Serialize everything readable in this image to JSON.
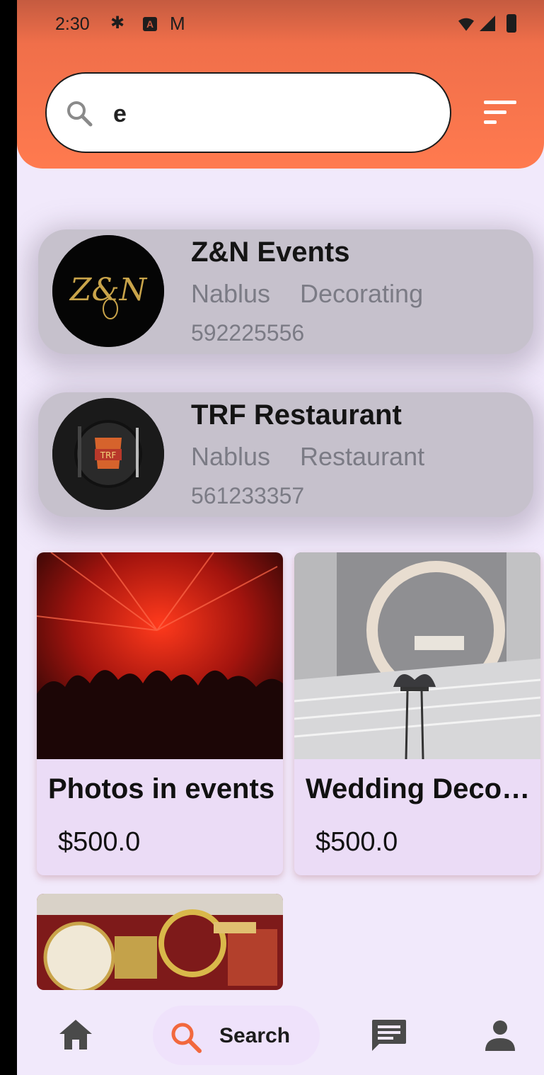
{
  "status_bar": {
    "time": "2:30"
  },
  "search": {
    "value": "e"
  },
  "providers": [
    {
      "name": "Z&N Events",
      "city": "Nablus",
      "category": "Decorating",
      "phone": "592225556",
      "avatar_text": "Z&N"
    },
    {
      "name": "TRF Restaurant",
      "city": "Nablus",
      "category": "Restaurant",
      "phone": "561233357",
      "avatar_text": "TRF"
    }
  ],
  "services": [
    {
      "title": "Photos in events",
      "price": "$500.0"
    },
    {
      "title": "Wedding Decoration",
      "price": "$500.0"
    },
    {
      "title": "",
      "price": ""
    }
  ],
  "bottom_nav": {
    "active_label": "Search"
  },
  "colors": {
    "header_accent": "#ff7a4f",
    "background": "#f1e9fb",
    "card": "#ebdcf6",
    "nav_active_icon": "#f2683d"
  }
}
